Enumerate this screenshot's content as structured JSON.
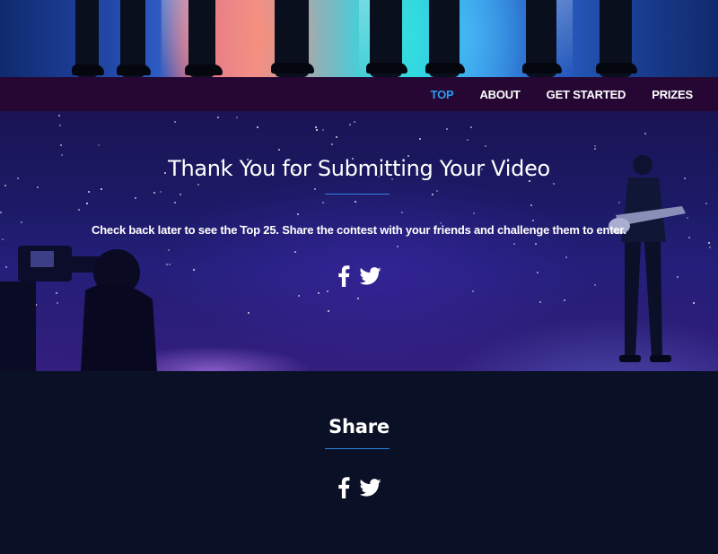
{
  "nav": {
    "items": [
      {
        "label": "TOP",
        "active": true
      },
      {
        "label": "ABOUT",
        "active": false
      },
      {
        "label": "GET STARTED",
        "active": false
      },
      {
        "label": "PRIZES",
        "active": false
      }
    ]
  },
  "thanks": {
    "title": "Thank You for Submitting Your Video",
    "message": "Check back later to see the Top 25. Share the contest with your friends and challenge them to enter.",
    "icons": [
      "facebook-icon",
      "twitter-icon"
    ]
  },
  "share": {
    "title": "Share",
    "icons": [
      "facebook-icon",
      "twitter-icon"
    ]
  },
  "colors": {
    "nav_bg": "#260733",
    "nav_active": "#2d9cf2",
    "accent_rule": "#2d82e0",
    "share_bg": "#0a1126"
  }
}
